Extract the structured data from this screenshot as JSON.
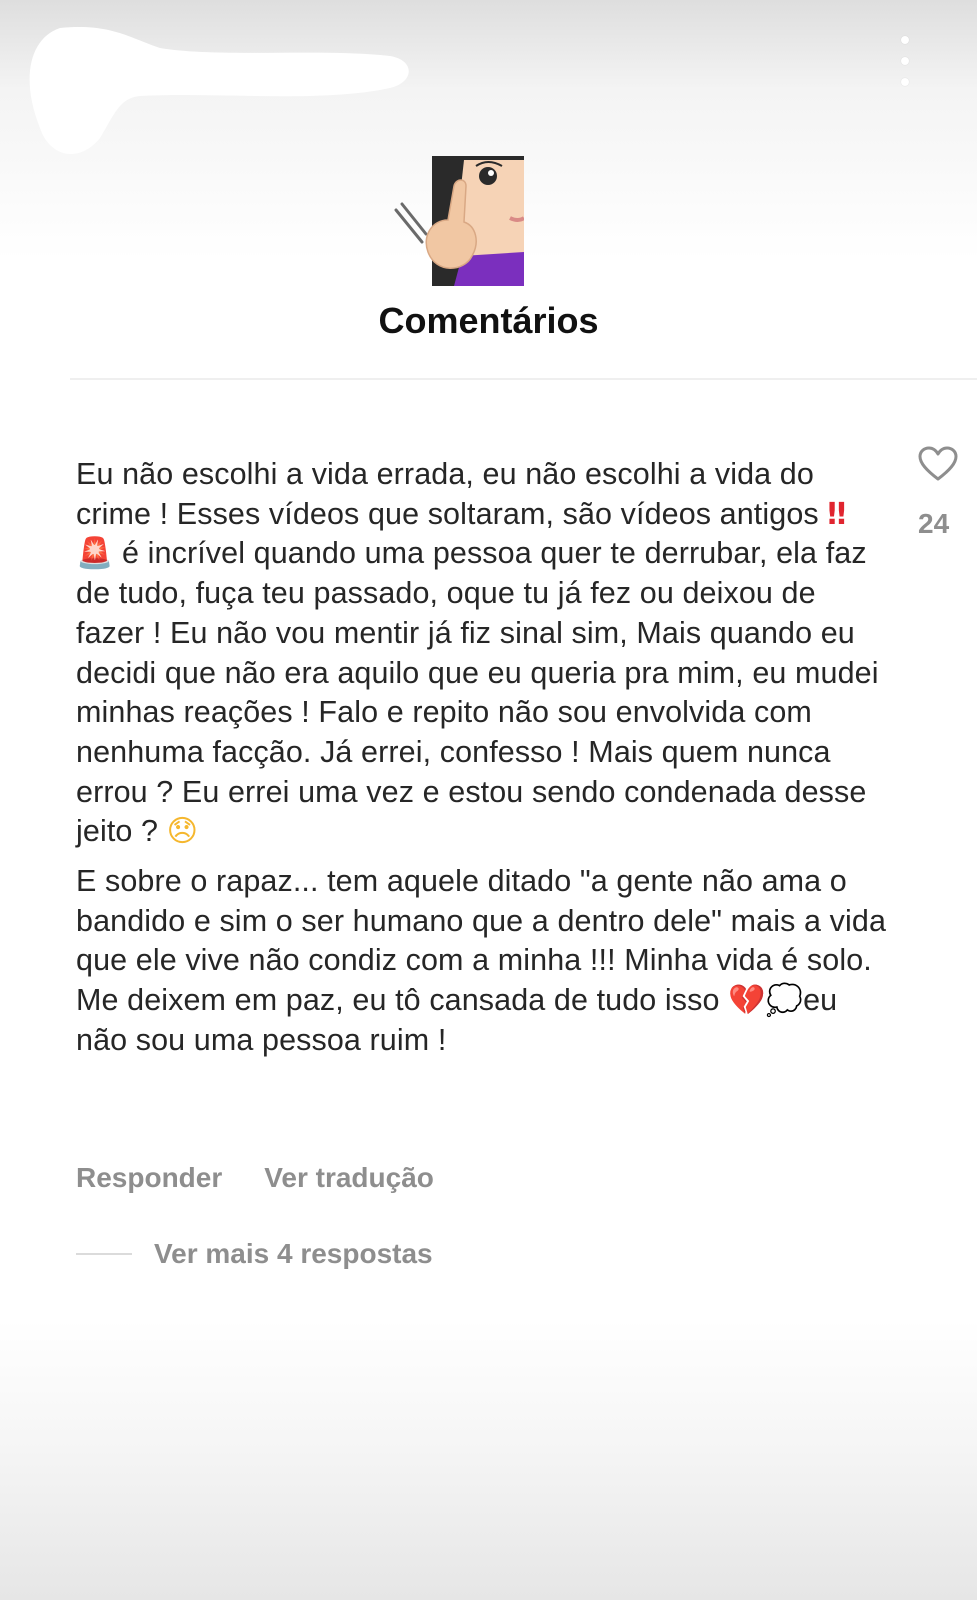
{
  "header": {
    "title": "Comentários"
  },
  "comment": {
    "paragraph1": {
      "text1": "Eu não escolhi a vida errada, eu não escolhi a vida do crime ! Esses vídeos que soltaram, são vídeos antigos ",
      "emoji_exclamation": "‼",
      "emoji_siren": "🚨",
      "text2": " é incrível quando uma pessoa quer te derrubar, ela faz de tudo, fuça teu passado, oque tu já fez ou deixou de fazer ! Eu não vou mentir já fiz sinal sim, Mais quando eu decidi que não era aquilo que eu queria pra mim, eu mudei minhas reações ! Falo e repito não sou envolvida com nenhuma facção. Já errei, confesso ! Mais quem nunca errou ? Eu errei uma vez e estou sendo condenada desse jeito ? ",
      "emoji_sad": "😞"
    },
    "paragraph2": {
      "text1": "E sobre o rapaz... tem aquele ditado \"a gente não ama o bandido e sim o ser humano que a dentro dele\" mais a vida que ele vive não condiz com a minha !!! Minha vida é solo. Me deixem em paz, eu tô cansada de tudo isso ",
      "emoji_heartbreak": "💔",
      "emoji_bubble": "💭",
      "text2": "eu não sou uma pessoa ruim !"
    },
    "actions": {
      "reply": "Responder",
      "translate": "Ver tradução"
    },
    "view_more": "Ver mais 4 respostas",
    "likes": "24"
  },
  "icons": {
    "menu": "more-vertical-icon",
    "like": "heart-outline-icon",
    "avatar_emoji": "woman-shushing-emoji"
  },
  "colors": {
    "text": "#262626",
    "secondary": "#8e8e8e",
    "divider": "#efefef"
  }
}
